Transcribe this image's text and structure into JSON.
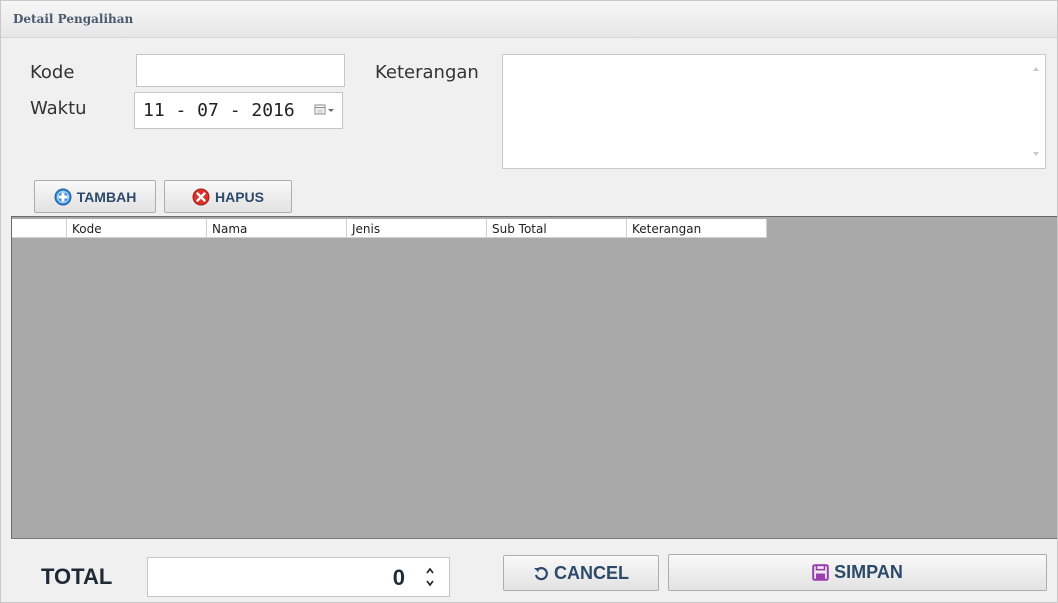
{
  "window": {
    "title": "Detail Pengalihan"
  },
  "form": {
    "kode_label": "Kode",
    "kode_value": "",
    "waktu_label": "Waktu",
    "waktu_value": "11 - 07 - 2016",
    "keterangan_label": "Keterangan",
    "keterangan_value": ""
  },
  "toolbar": {
    "tambah_label": "TAMBAH",
    "tambah_icon": "plus-circle-icon",
    "hapus_label": "HAPUS",
    "hapus_icon": "x-circle-icon"
  },
  "table": {
    "columns": [
      "Kode",
      "Nama",
      "Jenis",
      "Sub Total",
      "Keterangan"
    ],
    "rows": []
  },
  "footer": {
    "total_label": "TOTAL",
    "total_value": "0",
    "cancel_label": "CANCEL",
    "cancel_icon": "undo-icon",
    "simpan_label": "SIMPAN",
    "simpan_icon": "save-icon"
  },
  "colors": {
    "grid_background": "#a9a9a9",
    "button_text": "#2d4a6b",
    "tambah_icon": "#2f7fcf",
    "hapus_icon": "#d9332b",
    "simpan_icon": "#9b3fae"
  }
}
